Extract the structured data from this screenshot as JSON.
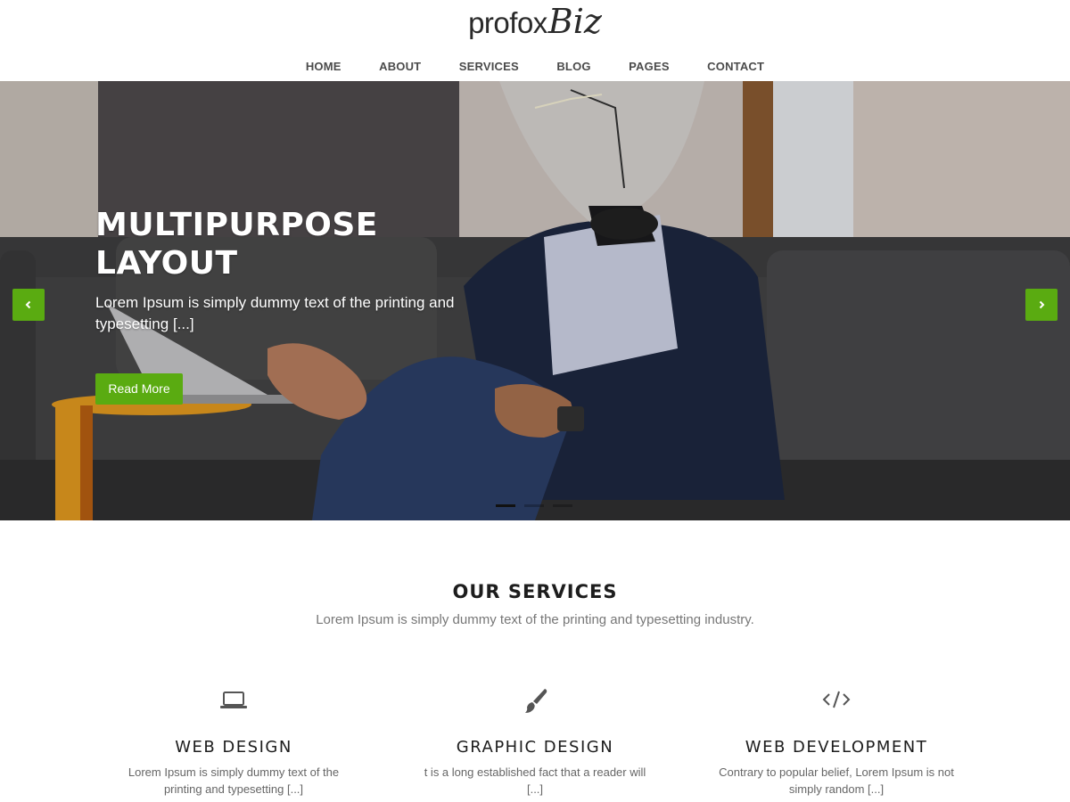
{
  "header": {
    "logo_main": "profox",
    "logo_script": "Biz",
    "nav": [
      "HOME",
      "ABOUT",
      "SERVICES",
      "BLOG",
      "PAGES",
      "CONTACT"
    ]
  },
  "hero": {
    "title": "MULTIPURPOSE LAYOUT",
    "subtitle": "Lorem Ipsum is simply dummy text of the printing and typesetting [...]",
    "button": "Read More",
    "slide_count": 3,
    "active_slide": 1
  },
  "services": {
    "title": "OUR SERVICES",
    "subtitle": "Lorem Ipsum is simply dummy text of the printing and typesetting industry.",
    "items": [
      {
        "icon": "laptop-icon",
        "title": "WEB DESIGN",
        "text": "Lorem Ipsum is simply dummy text of the printing and typesetting [...]"
      },
      {
        "icon": "paintbrush-icon",
        "title": "GRAPHIC DESIGN",
        "text": "t is a long established fact that a reader will [...]"
      },
      {
        "icon": "code-icon",
        "title": "WEB DEVELOPMENT",
        "text": "Contrary to popular belief, Lorem Ipsum is not simply random [...]"
      }
    ]
  },
  "colors": {
    "accent": "#5aab11",
    "heading": "#1d1d1d",
    "nav_text": "#4b4b4b"
  }
}
